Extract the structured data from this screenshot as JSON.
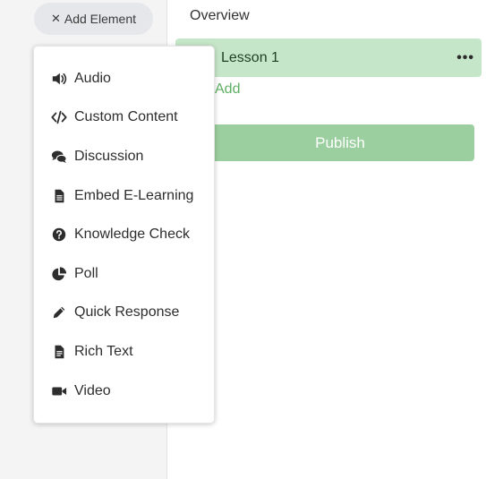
{
  "sidebar": {
    "add_element": {
      "icon": "close-icon",
      "icon_glyph": "✕",
      "label": "Add Element"
    }
  },
  "main": {
    "overview": "Overview",
    "lesson": {
      "title": "Lesson 1",
      "more_glyph": "•••"
    },
    "add_link": "Add",
    "publish": "Publish"
  },
  "dropdown": {
    "items": [
      {
        "label": "Audio",
        "icon": "volume-icon"
      },
      {
        "label": "Custom Content",
        "icon": "code-icon"
      },
      {
        "label": "Discussion",
        "icon": "comments-icon"
      },
      {
        "label": "Embed E-Learning",
        "icon": "file-document-icon"
      },
      {
        "label": "Knowledge Check",
        "icon": "question-circle-icon"
      },
      {
        "label": "Poll",
        "icon": "pie-chart-icon"
      },
      {
        "label": "Quick Response",
        "icon": "pencil-icon"
      },
      {
        "label": "Rich Text",
        "icon": "file-text-icon"
      },
      {
        "label": "Video",
        "icon": "video-camera-icon"
      }
    ]
  },
  "colors": {
    "lesson_bg": "#c6e6c9",
    "publish_bg": "#9ccf9f",
    "add_link": "#5fb063",
    "sidebar_bg": "#f4f4f5"
  }
}
